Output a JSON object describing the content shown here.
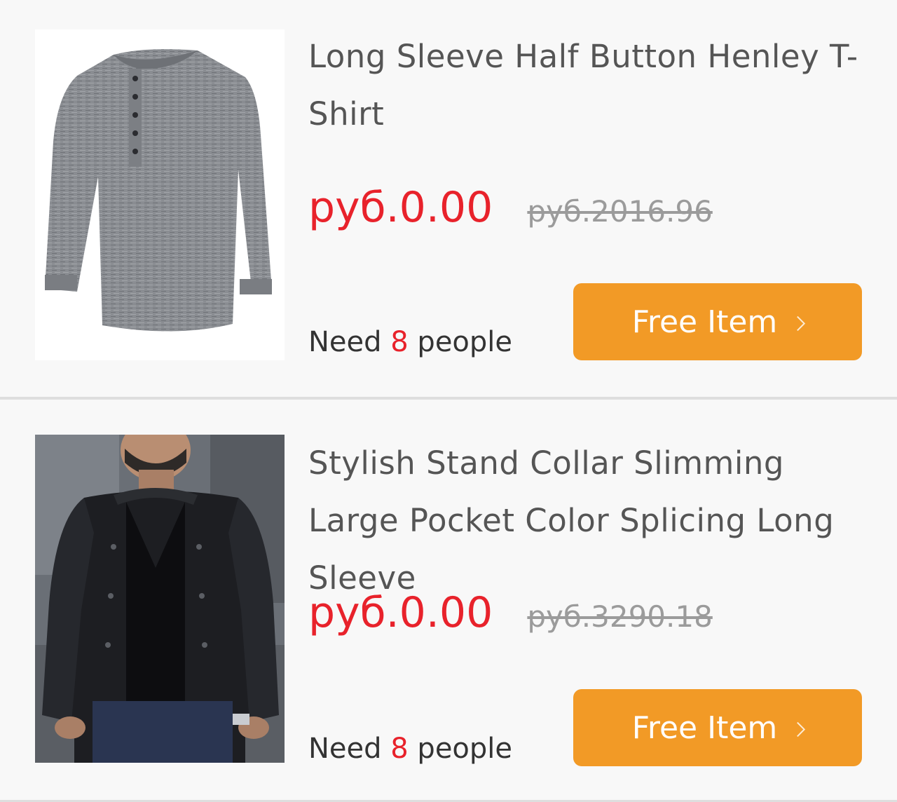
{
  "products": [
    {
      "title": "Long Sleeve Half Button Henley T-Shirt",
      "price": "руб.0.00",
      "original_price": "руб.2016.96",
      "need_prefix": "Need",
      "need_count": "8",
      "need_suffix": "people",
      "button_label": "Free Item",
      "image": "grey-henley-shirt"
    },
    {
      "title": "Stylish Stand Collar Slimming Large Pocket Color Splicing Long Sleeve",
      "price": "руб.0.00",
      "original_price": "руб.3290.18",
      "need_prefix": "Need",
      "need_count": "8",
      "need_suffix": "people",
      "button_label": "Free Item",
      "image": "black-bomber-jacket-model"
    }
  ],
  "colors": {
    "price": "#e8222b",
    "button": "#f29a26",
    "old_price": "#9b9b9b",
    "title": "#555555"
  },
  "icons": {
    "button_arrow": "chevron-right-icon"
  }
}
